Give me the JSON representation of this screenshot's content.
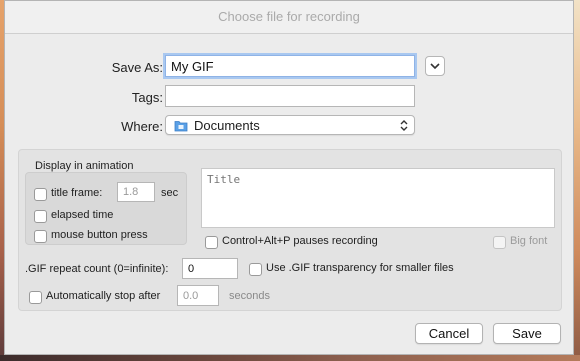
{
  "dialog": {
    "title": "Choose file for recording",
    "save_as_label": "Save As:",
    "save_as_value": "My GIF",
    "tags_label": "Tags:",
    "tags_value": "",
    "where_label": "Where:",
    "where_value": "Documents",
    "where_icon": "folder-icon",
    "expand_icon": "chevron-down-icon"
  },
  "animation": {
    "group_title": "Display in animation",
    "title_frame_label": "title frame:",
    "title_frame_value": "1.8",
    "title_frame_unit": "sec",
    "title_frame_checked": false,
    "elapsed_time_label": "elapsed time",
    "elapsed_time_checked": false,
    "mouse_press_label": "mouse button press",
    "mouse_press_checked": false,
    "title_placeholder": "Title",
    "pause_shortcut_label": "Control+Alt+P pauses recording",
    "pause_shortcut_checked": false,
    "big_font_label": "Big font",
    "big_font_checked": false,
    "repeat_label": ".GIF repeat count (0=infinite):",
    "repeat_value": "0",
    "transparency_label": "Use .GIF transparency for smaller files",
    "transparency_checked": false,
    "auto_stop_label": "Automatically stop after",
    "auto_stop_value": "0.0",
    "auto_stop_unit": "seconds",
    "auto_stop_checked": false
  },
  "buttons": {
    "cancel": "Cancel",
    "save": "Save"
  },
  "colors": {
    "dialog_bg": "#ececec",
    "folder_icon": "#4a90d9"
  }
}
